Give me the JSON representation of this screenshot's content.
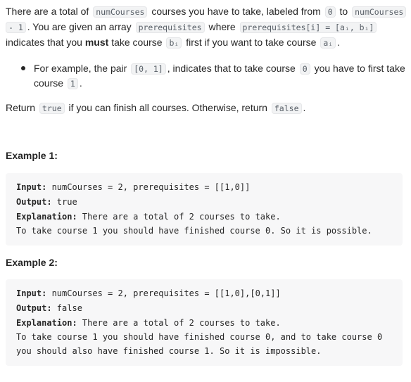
{
  "paragraph1": {
    "line1": {
      "t1": "There are a total of",
      "c1": "numCourses",
      "t2": "courses you have to take, labeled from",
      "c2": "0",
      "t3": "to",
      "c3": "numCourses"
    },
    "line2": {
      "c1": "- 1",
      "t1": ". You are given an array",
      "c2": "prerequisites",
      "t2": "where",
      "c3": "prerequisites[i] = [aᵢ, bᵢ]"
    },
    "line3": {
      "t1": "indicates that you",
      "strong": "must",
      "t2": "take course",
      "c1": "bᵢ",
      "t3": "first if you want to take course",
      "c2": "aᵢ",
      "t4": "."
    }
  },
  "bullet": {
    "line1": {
      "t1": "For example, the pair",
      "c1": "[0, 1]",
      "t2": ", indicates that to take course",
      "c2": "0",
      "t3": "you have to first take"
    },
    "line2": {
      "t1": "course",
      "c1": "1",
      "t2": "."
    }
  },
  "return_line": {
    "t1": "Return",
    "c1": "true",
    "t2": "if you can finish all courses. Otherwise, return",
    "c2": "false",
    "t3": "."
  },
  "example1": {
    "heading": "Example 1:",
    "input_label": "Input:",
    "input_value": " numCourses = 2, prerequisites = [[1,0]]",
    "output_label": "Output:",
    "output_value": " true",
    "explanation_label": "Explanation:",
    "explanation_value": " There are a total of 2 courses to take.",
    "explanation_line2": "To take course 1 you should have finished course 0. So it is possible."
  },
  "example2": {
    "heading": "Example 2:",
    "input_label": "Input:",
    "input_value": " numCourses = 2, prerequisites = [[1,0],[0,1]]",
    "output_label": "Output:",
    "output_value": " false",
    "explanation_label": "Explanation:",
    "explanation_value": " There are a total of 2 courses to take.",
    "explanation_line2": "To take course 1 you should have finished course 0, and to take course 0",
    "explanation_line3": "you should also have finished course 1. So it is impossible."
  }
}
